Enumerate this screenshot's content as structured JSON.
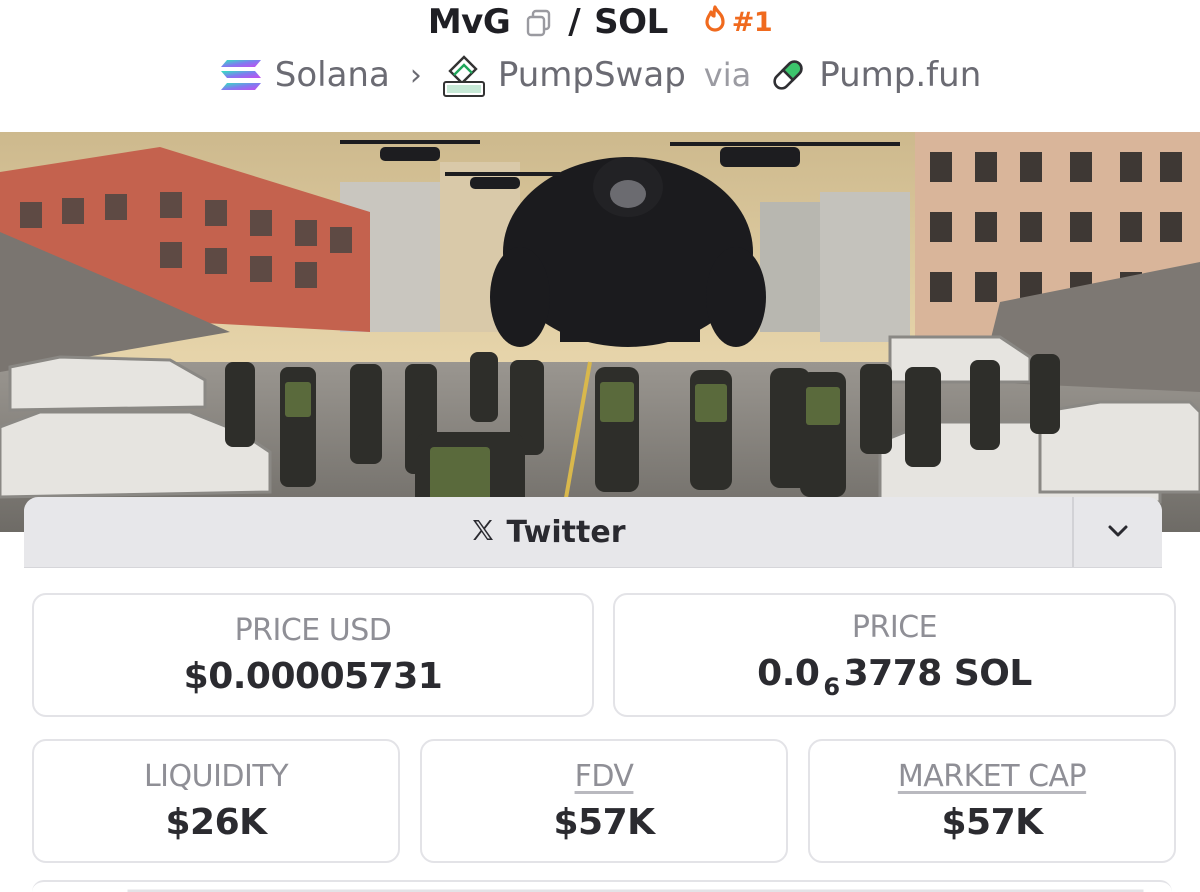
{
  "header": {
    "token_symbol": "MvG",
    "separator": "/",
    "quote_symbol": "SOL",
    "rank_label": "#1",
    "chain": "Solana",
    "dex": "PumpSwap",
    "via_label": "via",
    "launchpad": "Pump.fun"
  },
  "icons": {
    "copy": "copy-icon",
    "rank": "flame-icon",
    "chain": "solana-logo-icon",
    "dex": "pumpswap-logo-icon",
    "launchpad": "pill-icon",
    "breadcrumb_separator": "chevron-right-icon",
    "social": "x-logo-icon",
    "toggle": "chevron-down-icon"
  },
  "banner": {
    "description_icon": "token-banner-image"
  },
  "socials": {
    "label": "Twitter"
  },
  "stats": {
    "price_usd": {
      "label": "PRICE USD",
      "value": "$0.00005731"
    },
    "price_native": {
      "label": "PRICE",
      "value_prefix": "0.0",
      "zeros_subscript": "6",
      "value_digits": "3778",
      "value_suffix": "SOL"
    },
    "liquidity": {
      "label": "LIQUIDITY",
      "value": "$26K"
    },
    "fdv": {
      "label": "FDV",
      "value": "$57K"
    },
    "market_cap": {
      "label": "MARKET CAP",
      "value": "$57K"
    }
  },
  "colors": {
    "accent_orange": "#f06a1e",
    "card_border": "#e3e3e7",
    "label_gray": "#8f8f96",
    "dex_green": "#1fa65a"
  }
}
